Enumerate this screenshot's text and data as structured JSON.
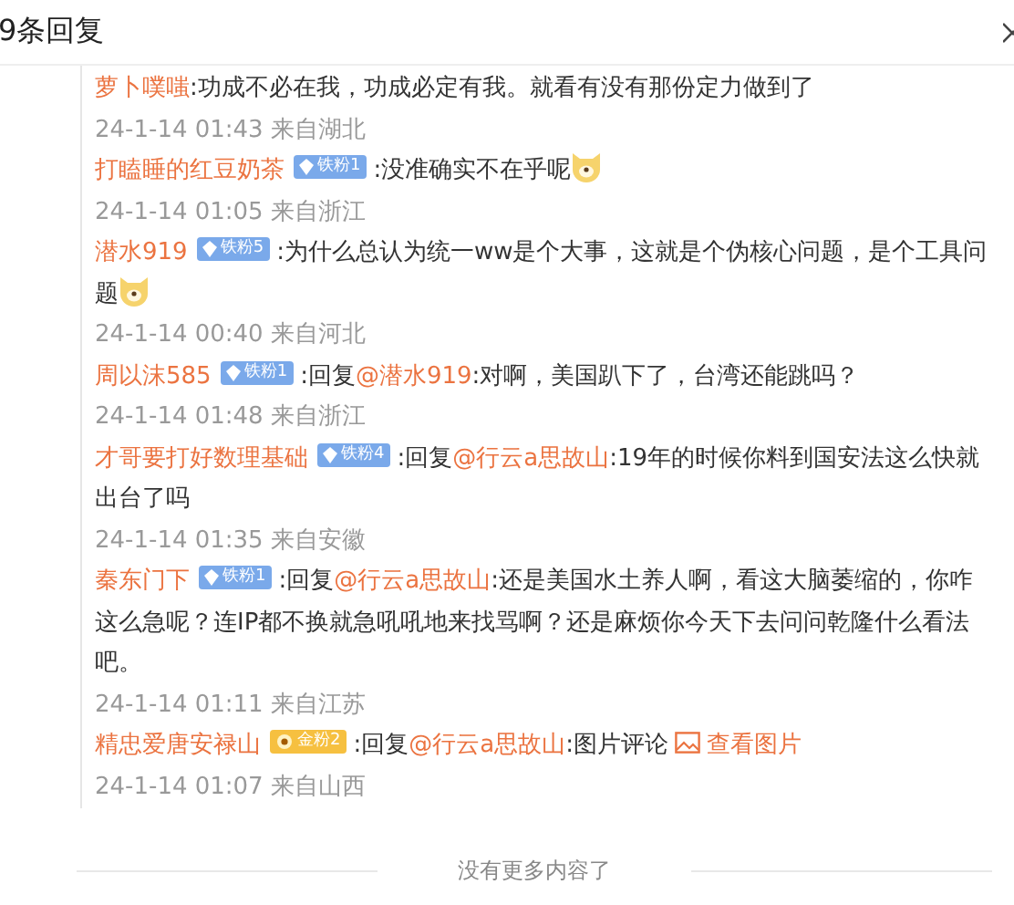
{
  "header": {
    "title": "9条回复"
  },
  "comments": [
    {
      "user": "萝卜噗嗤",
      "text": ":功成不必在我，功成必定有我。就看有没有那份定力做到了",
      "meta": "24-1-14 01:43 来自湖北"
    },
    {
      "user": "打瞌睡的红豆奶茶",
      "badge": {
        "kind": "iron",
        "label": "铁粉1"
      },
      "text": ":没准确实不在乎呢",
      "emoji": true,
      "meta": "24-1-14 01:05 来自浙江"
    },
    {
      "user": "潜水919",
      "badge": {
        "kind": "iron",
        "label": "铁粉5"
      },
      "text": ":为什么总认为统一ww是个大事，这就是个伪核心问题，是个工具问题",
      "emoji": true,
      "meta": "24-1-14 00:40 来自河北"
    },
    {
      "user": "周以沫585",
      "badge": {
        "kind": "iron",
        "label": "铁粉1"
      },
      "reply": ":回复",
      "mention": "@潜水919",
      "text": ":对啊，美国趴下了，台湾还能跳吗？",
      "meta": "24-1-14 01:48 来自浙江"
    },
    {
      "user": "才哥要打好数理基础",
      "badge": {
        "kind": "iron",
        "label": "铁粉4"
      },
      "reply": ":回复",
      "mention": "@行云a思故山",
      "text": ":19年的时候你料到国安法这么快就出台了吗",
      "meta": "24-1-14 01:35 来自安徽"
    },
    {
      "user": "秦东门下",
      "badge": {
        "kind": "iron",
        "label": "铁粉1"
      },
      "reply": ":回复",
      "mention": "@行云a思故山",
      "text": ":还是美国水土养人啊，看这大脑萎缩的，你咋这么急呢？连IP都不换就急吼吼地来找骂啊？还是麻烦你今天下去问问乾隆什么看法吧。",
      "meta": "24-1-14 01:11 来自江苏"
    },
    {
      "user": "精忠爱唐安禄山",
      "badge": {
        "kind": "gold",
        "label": "金粉2"
      },
      "reply": ":回复",
      "mention": "@行云a思故山",
      "text": ":图片评论",
      "image_link": "查看图片",
      "meta": "24-1-14 01:07 来自山西"
    }
  ],
  "footer": {
    "text": "没有更多内容了"
  }
}
